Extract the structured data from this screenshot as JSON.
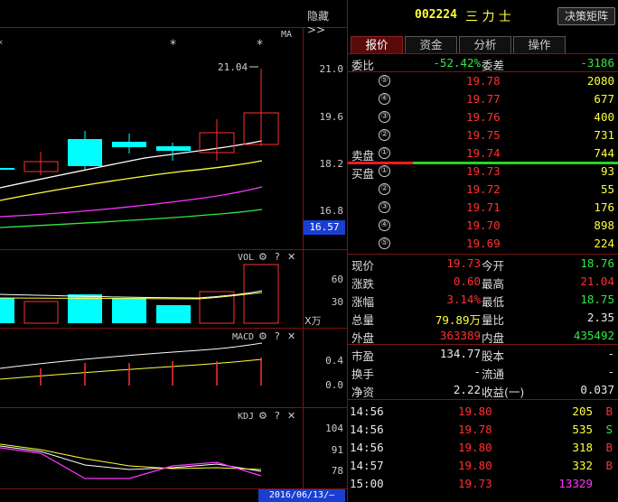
{
  "chart": {
    "hide_button": "隐藏>>",
    "ma_label": "MA",
    "price_axis": [
      "21.0",
      "19.6",
      "18.2",
      "16.8"
    ],
    "price_marker": "16.57",
    "high_marker": "21.04",
    "vol_title": "VOL",
    "vol_axis": [
      "60",
      "30"
    ],
    "vol_unit": "X万",
    "macd_title": "MACD",
    "macd_axis": [
      "0.4",
      "0.0"
    ],
    "kdj_title": "KDJ",
    "kdj_axis": [
      "104",
      "91",
      "78"
    ],
    "date_label": "2016/06/13/—",
    "icons": [
      "gear-icon",
      "question-icon",
      "close-icon"
    ]
  },
  "stock": {
    "code": "002224",
    "name": "三 力 士",
    "matrix_button": "决策矩阵"
  },
  "tabs": [
    {
      "label": "报价",
      "active": true
    },
    {
      "label": "资金",
      "active": false
    },
    {
      "label": "分析",
      "active": false
    },
    {
      "label": "操作",
      "active": false
    }
  ],
  "ratio": {
    "label1": "委比",
    "value1": "-52.42%",
    "label2": "委差",
    "value2": "-3186"
  },
  "sell": [
    {
      "idx": "⑤",
      "price": "19.78",
      "vol": "2080"
    },
    {
      "idx": "④",
      "price": "19.77",
      "vol": "677"
    },
    {
      "idx": "③",
      "price": "19.76",
      "vol": "400"
    },
    {
      "idx": "②",
      "price": "19.75",
      "vol": "731"
    },
    {
      "idx": "①",
      "price": "19.74",
      "vol": "744",
      "label": "卖盘"
    }
  ],
  "buy": [
    {
      "idx": "①",
      "price": "19.73",
      "vol": "93",
      "label": "买盘"
    },
    {
      "idx": "②",
      "price": "19.72",
      "vol": "55"
    },
    {
      "idx": "③",
      "price": "19.71",
      "vol": "176"
    },
    {
      "idx": "④",
      "price": "19.70",
      "vol": "898"
    },
    {
      "idx": "⑤",
      "price": "19.69",
      "vol": "224"
    }
  ],
  "quote": [
    {
      "l1": "现价",
      "v1": "19.73",
      "c1": "red",
      "l2": "今开",
      "v2": "18.76",
      "c2": "green"
    },
    {
      "l1": "涨跌",
      "v1": "0.60",
      "c1": "red",
      "l2": "最高",
      "v2": "21.04",
      "c2": "red"
    },
    {
      "l1": "涨幅",
      "v1": "3.14%",
      "c1": "red",
      "l2": "最低",
      "v2": "18.75",
      "c2": "green"
    },
    {
      "l1": "总量",
      "v1": "79.89万",
      "c1": "yellow",
      "l2": "量比",
      "v2": "2.35",
      "c2": "white"
    },
    {
      "l1": "外盘",
      "v1": "363389",
      "c1": "red",
      "l2": "内盘",
      "v2": "435492",
      "c2": "green"
    }
  ],
  "fundamentals": [
    {
      "l1": "市盈",
      "v1": "134.77",
      "l2": "股本",
      "v2": "-"
    },
    {
      "l1": "换手",
      "v1": "-",
      "l2": "流通",
      "v2": "-"
    },
    {
      "l1": "净资",
      "v1": "2.22",
      "l2": "收益(一)",
      "v2": "0.037"
    }
  ],
  "ticks": [
    {
      "time": "14:56",
      "price": "19.80",
      "vol": "205",
      "side": "B"
    },
    {
      "time": "14:56",
      "price": "19.78",
      "vol": "535",
      "side": "S"
    },
    {
      "time": "14:56",
      "price": "19.80",
      "vol": "318",
      "side": "B"
    },
    {
      "time": "14:57",
      "price": "19.80",
      "vol": "332",
      "side": "B"
    },
    {
      "time": "15:00",
      "price": "19.73",
      "vol": "13329",
      "side": ""
    }
  ],
  "colors": {
    "up": "#ff3030",
    "down": "#31e842",
    "cyan": "#00ffff",
    "grid": "#7a1414",
    "yellow": "#ffff3c",
    "magenta": "#ff35ff"
  }
}
